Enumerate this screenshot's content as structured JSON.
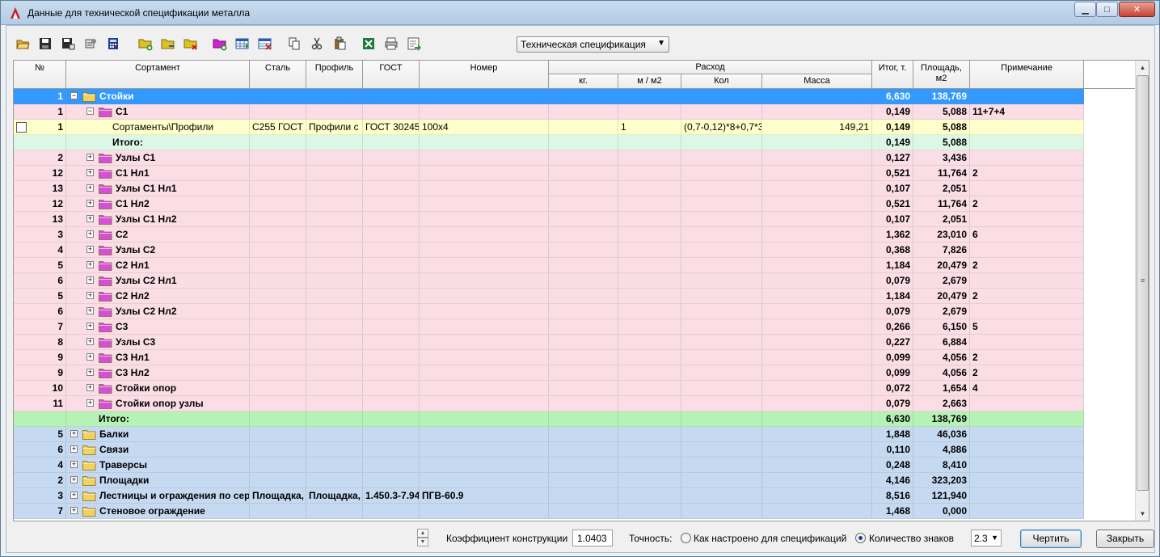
{
  "window": {
    "title": "Данные для технической спецификации металла",
    "minimize_glyph": "▁",
    "maximize_glyph": "□",
    "close_glyph": "✕"
  },
  "toolbar": {
    "buttons": [
      {
        "name": "open-folder-icon",
        "color": "#e0b040"
      },
      {
        "name": "save-icon",
        "color": "#2b2b2b"
      },
      {
        "name": "save-as-icon",
        "color": "#2b2b2b"
      },
      {
        "name": "settings-icon",
        "color": "#505050"
      },
      {
        "name": "calculator-icon",
        "color": "#1e3e8c"
      },
      {
        "name": "add-folder-icon",
        "color": "#e0c020"
      },
      {
        "name": "folder-icon",
        "color": "#e0c020"
      },
      {
        "name": "delete-folder-icon",
        "color": "#e0c020"
      },
      {
        "name": "add-group-icon",
        "color": "#d020d0"
      },
      {
        "name": "add-row-icon",
        "color": "#2a5aa8"
      },
      {
        "name": "delete-row-icon",
        "color": "#c02020"
      },
      {
        "name": "copy-icon",
        "color": "#404040"
      },
      {
        "name": "cut-icon",
        "color": "#404040"
      },
      {
        "name": "paste-icon",
        "color": "#8a6a2a"
      },
      {
        "name": "excel-icon",
        "color": "#1e7a3a"
      },
      {
        "name": "print-icon",
        "color": "#505050"
      },
      {
        "name": "export-icon",
        "color": "#3a8a3a"
      }
    ],
    "spec_select": {
      "value": "Техническая спецификация",
      "arrow": "▼"
    }
  },
  "grid": {
    "headers": {
      "num": "№",
      "sortament": "Сортамент",
      "steel": "Сталь",
      "profile": "Профиль",
      "gost": "ГОСТ",
      "number": "Номер",
      "rashod": "Расход",
      "kg": "кг.",
      "m_m2": "м / м2",
      "kol": "Кол",
      "massa": "Масса",
      "itog": "Итог, т.",
      "area_line1": "Площадь,",
      "area_line2": "м2",
      "note": "Примечание"
    },
    "rows": [
      {
        "style": "selected",
        "num": "1",
        "level": 0,
        "expander": "−",
        "folder": "yellow",
        "name": "Стойки",
        "steel": "",
        "profile": "",
        "gost": "",
        "number": "",
        "kg": "",
        "m_m2": "",
        "kol": "",
        "massa": "",
        "itog": "6,630",
        "area": "138,769",
        "note": "",
        "bold": true
      },
      {
        "style": "pink",
        "num": "1",
        "level": 1,
        "expander": "−",
        "folder": "pink",
        "name": "С1",
        "steel": "",
        "profile": "",
        "gost": "",
        "number": "",
        "kg": "",
        "m_m2": "",
        "kol": "",
        "massa": "",
        "itog": "0,149",
        "area": "5,088",
        "note": "11+7+4",
        "bold": true
      },
      {
        "style": "yellow",
        "num": "1",
        "level": 2,
        "expander": "",
        "folder": "",
        "checkbox": true,
        "name": "Сортаменты\\Профили",
        "steel": "С255 ГОСТ 2",
        "profile": "Профили с",
        "gost": "ГОСТ 30245",
        "number": "100х4",
        "kg": "",
        "m_m2": "1",
        "kol": "(0,7-0,12)*8+0,7*3",
        "massa": "149,21",
        "itog": "0,149",
        "area": "5,088",
        "note": "",
        "bold": false
      },
      {
        "style": "mint",
        "num": "",
        "level": 2,
        "expander": "",
        "folder": "",
        "name": "Итого:",
        "steel": "",
        "profile": "",
        "gost": "",
        "number": "",
        "kg": "",
        "m_m2": "",
        "kol": "",
        "massa": "",
        "itog": "0,149",
        "area": "5,088",
        "note": "",
        "bold": true
      },
      {
        "style": "pink",
        "num": "2",
        "level": 1,
        "expander": "+",
        "folder": "pink",
        "name": "Узлы С1",
        "steel": "",
        "profile": "",
        "gost": "",
        "number": "",
        "kg": "",
        "m_m2": "",
        "kol": "",
        "massa": "",
        "itog": "0,127",
        "area": "3,436",
        "note": "",
        "bold": true
      },
      {
        "style": "pink",
        "num": "12",
        "level": 1,
        "expander": "+",
        "folder": "pink",
        "name": "С1 Нл1",
        "steel": "",
        "profile": "",
        "gost": "",
        "number": "",
        "kg": "",
        "m_m2": "",
        "kol": "",
        "massa": "",
        "itog": "0,521",
        "area": "11,764",
        "note": "2",
        "bold": true
      },
      {
        "style": "pink",
        "num": "13",
        "level": 1,
        "expander": "+",
        "folder": "pink",
        "name": "Узлы С1 Нл1",
        "steel": "",
        "profile": "",
        "gost": "",
        "number": "",
        "kg": "",
        "m_m2": "",
        "kol": "",
        "massa": "",
        "itog": "0,107",
        "area": "2,051",
        "note": "",
        "bold": true
      },
      {
        "style": "pink",
        "num": "12",
        "level": 1,
        "expander": "+",
        "folder": "pink",
        "name": "С1 Нл2",
        "steel": "",
        "profile": "",
        "gost": "",
        "number": "",
        "kg": "",
        "m_m2": "",
        "kol": "",
        "massa": "",
        "itog": "0,521",
        "area": "11,764",
        "note": "2",
        "bold": true
      },
      {
        "style": "pink",
        "num": "13",
        "level": 1,
        "expander": "+",
        "folder": "pink",
        "name": "Узлы С1 Нл2",
        "steel": "",
        "profile": "",
        "gost": "",
        "number": "",
        "kg": "",
        "m_m2": "",
        "kol": "",
        "massa": "",
        "itog": "0,107",
        "area": "2,051",
        "note": "",
        "bold": true
      },
      {
        "style": "pink",
        "num": "3",
        "level": 1,
        "expander": "+",
        "folder": "pink",
        "name": "С2",
        "steel": "",
        "profile": "",
        "gost": "",
        "number": "",
        "kg": "",
        "m_m2": "",
        "kol": "",
        "massa": "",
        "itog": "1,362",
        "area": "23,010",
        "note": "6",
        "bold": true
      },
      {
        "style": "pink",
        "num": "4",
        "level": 1,
        "expander": "+",
        "folder": "pink",
        "name": "Узлы С2",
        "steel": "",
        "profile": "",
        "gost": "",
        "number": "",
        "kg": "",
        "m_m2": "",
        "kol": "",
        "massa": "",
        "itog": "0,368",
        "area": "7,826",
        "note": "",
        "bold": true
      },
      {
        "style": "pink",
        "num": "5",
        "level": 1,
        "expander": "+",
        "folder": "pink",
        "name": "С2 Нл1",
        "steel": "",
        "profile": "",
        "gost": "",
        "number": "",
        "kg": "",
        "m_m2": "",
        "kol": "",
        "massa": "",
        "itog": "1,184",
        "area": "20,479",
        "note": "2",
        "bold": true
      },
      {
        "style": "pink",
        "num": "6",
        "level": 1,
        "expander": "+",
        "folder": "pink",
        "name": "Узлы С2 Нл1",
        "steel": "",
        "profile": "",
        "gost": "",
        "number": "",
        "kg": "",
        "m_m2": "",
        "kol": "",
        "massa": "",
        "itog": "0,079",
        "area": "2,679",
        "note": "",
        "bold": true
      },
      {
        "style": "pink",
        "num": "5",
        "level": 1,
        "expander": "+",
        "folder": "pink",
        "name": "С2 Нл2",
        "steel": "",
        "profile": "",
        "gost": "",
        "number": "",
        "kg": "",
        "m_m2": "",
        "kol": "",
        "massa": "",
        "itog": "1,184",
        "area": "20,479",
        "note": "2",
        "bold": true
      },
      {
        "style": "pink",
        "num": "6",
        "level": 1,
        "expander": "+",
        "folder": "pink",
        "name": "Узлы С2 Нл2",
        "steel": "",
        "profile": "",
        "gost": "",
        "number": "",
        "kg": "",
        "m_m2": "",
        "kol": "",
        "massa": "",
        "itog": "0,079",
        "area": "2,679",
        "note": "",
        "bold": true
      },
      {
        "style": "pink",
        "num": "7",
        "level": 1,
        "expander": "+",
        "folder": "pink",
        "name": "С3",
        "steel": "",
        "profile": "",
        "gost": "",
        "number": "",
        "kg": "",
        "m_m2": "",
        "kol": "",
        "massa": "",
        "itog": "0,266",
        "area": "6,150",
        "note": "5",
        "bold": true
      },
      {
        "style": "pink",
        "num": "8",
        "level": 1,
        "expander": "+",
        "folder": "pink",
        "name": "Узлы С3",
        "steel": "",
        "profile": "",
        "gost": "",
        "number": "",
        "kg": "",
        "m_m2": "",
        "kol": "",
        "massa": "",
        "itog": "0,227",
        "area": "6,884",
        "note": "",
        "bold": true
      },
      {
        "style": "pink",
        "num": "9",
        "level": 1,
        "expander": "+",
        "folder": "pink",
        "name": "С3 Нл1",
        "steel": "",
        "profile": "",
        "gost": "",
        "number": "",
        "kg": "",
        "m_m2": "",
        "kol": "",
        "massa": "",
        "itog": "0,099",
        "area": "4,056",
        "note": "2",
        "bold": true
      },
      {
        "style": "pink",
        "num": "9",
        "level": 1,
        "expander": "+",
        "folder": "pink",
        "name": "С3 Нл2",
        "steel": "",
        "profile": "",
        "gost": "",
        "number": "",
        "kg": "",
        "m_m2": "",
        "kol": "",
        "massa": "",
        "itog": "0,099",
        "area": "4,056",
        "note": "2",
        "bold": true
      },
      {
        "style": "pink",
        "num": "10",
        "level": 1,
        "expander": "+",
        "folder": "pink",
        "name": "Стойки опор",
        "steel": "",
        "profile": "",
        "gost": "",
        "number": "",
        "kg": "",
        "m_m2": "",
        "kol": "",
        "massa": "",
        "itog": "0,072",
        "area": "1,654",
        "note": "4",
        "bold": true
      },
      {
        "style": "pink",
        "num": "11",
        "level": 1,
        "expander": "+",
        "folder": "pink",
        "name": "Стойки опор узлы",
        "steel": "",
        "profile": "",
        "gost": "",
        "number": "",
        "kg": "",
        "m_m2": "",
        "kol": "",
        "massa": "",
        "itog": "0,079",
        "area": "2,663",
        "note": "",
        "bold": true
      },
      {
        "style": "green",
        "num": "",
        "level": 1,
        "expander": "",
        "folder": "",
        "name": "Итого:",
        "steel": "",
        "profile": "",
        "gost": "",
        "number": "",
        "kg": "",
        "m_m2": "",
        "kol": "",
        "massa": "",
        "itog": "6,630",
        "area": "138,769",
        "note": "",
        "bold": true
      },
      {
        "style": "blue",
        "num": "5",
        "level": 0,
        "expander": "+",
        "folder": "yellow",
        "name": "Балки",
        "steel": "",
        "profile": "",
        "gost": "",
        "number": "",
        "kg": "",
        "m_m2": "",
        "kol": "",
        "massa": "",
        "itog": "1,848",
        "area": "46,036",
        "note": "",
        "bold": true
      },
      {
        "style": "blue",
        "num": "6",
        "level": 0,
        "expander": "+",
        "folder": "yellow",
        "name": "Связи",
        "steel": "",
        "profile": "",
        "gost": "",
        "number": "",
        "kg": "",
        "m_m2": "",
        "kol": "",
        "massa": "",
        "itog": "0,110",
        "area": "4,886",
        "note": "",
        "bold": true
      },
      {
        "style": "blue",
        "num": "4",
        "level": 0,
        "expander": "+",
        "folder": "yellow",
        "name": "Траверсы",
        "steel": "",
        "profile": "",
        "gost": "",
        "number": "",
        "kg": "",
        "m_m2": "",
        "kol": "",
        "massa": "",
        "itog": "0,248",
        "area": "8,410",
        "note": "",
        "bold": true
      },
      {
        "style": "blue",
        "num": "2",
        "level": 0,
        "expander": "+",
        "folder": "yellow",
        "name": "Площадки",
        "steel": "",
        "profile": "",
        "gost": "",
        "number": "",
        "kg": "",
        "m_m2": "",
        "kol": "",
        "massa": "",
        "itog": "4,146",
        "area": "323,203",
        "note": "",
        "bold": true
      },
      {
        "style": "blue",
        "num": "3",
        "level": 0,
        "expander": "+",
        "folder": "yellow",
        "name": "Лестницы и ограждения  по сер.",
        "steel": "Площадка,",
        "profile": "Площадка,",
        "gost": "1.450.3-7.94",
        "number": "ПГВ-60.9",
        "kg": "",
        "m_m2": "",
        "kol": "",
        "massa": "",
        "itog": "8,516",
        "area": "121,940",
        "note": "",
        "bold": true
      },
      {
        "style": "blue",
        "num": "7",
        "level": 0,
        "expander": "+",
        "folder": "yellow",
        "name": "Стеновое ограждение",
        "steel": "",
        "profile": "",
        "gost": "",
        "number": "",
        "kg": "",
        "m_m2": "",
        "kol": "",
        "massa": "",
        "itog": "1,468",
        "area": "0,000",
        "note": "",
        "bold": true
      }
    ]
  },
  "bottom": {
    "spin_up": "▲",
    "spin_down": "▼",
    "coef_label": "Коэффициент конструкции",
    "coef_value": "1.0403",
    "precision_label": "Точность:",
    "radio1_label": "Как настроено для спецификаций",
    "radio1_checked": false,
    "radio2_label": "Количество знаков",
    "radio2_checked": true,
    "digits_value": "2.3",
    "digits_arrow": "▼",
    "draw_button": "Чертить",
    "close_button": "Закрыть"
  },
  "colors": {
    "selected": "#3399ff",
    "pink": "#fadde5",
    "yellow_row": "#ffffcc",
    "mint": "#ddf7e6",
    "green": "#b6f2b6",
    "blue": "#c5d9f1",
    "folder_yellow": "#f2d35a",
    "folder_pink": "#d64fd6"
  }
}
